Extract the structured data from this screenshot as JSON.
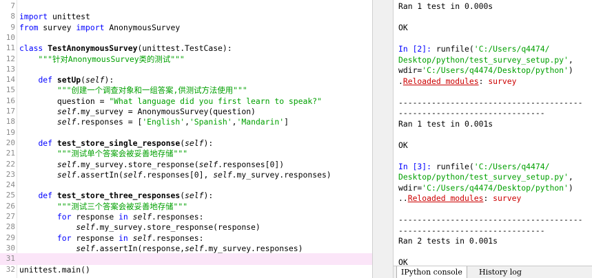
{
  "editor": {
    "lines": [
      {
        "n": "7",
        "parts": []
      },
      {
        "n": "8",
        "parts": [
          [
            "kw",
            "import"
          ],
          [
            "plain",
            " unittest"
          ]
        ]
      },
      {
        "n": "9",
        "parts": [
          [
            "kw",
            "from"
          ],
          [
            "plain",
            " survey "
          ],
          [
            "kw",
            "import"
          ],
          [
            "plain",
            " AnonymousSurvey"
          ]
        ]
      },
      {
        "n": "10",
        "parts": []
      },
      {
        "n": "11",
        "parts": [
          [
            "kw",
            "class"
          ],
          [
            "plain",
            " "
          ],
          [
            "fn",
            "TestAnonymousSurvey"
          ],
          [
            "plain",
            "(unittest.TestCase):"
          ]
        ]
      },
      {
        "n": "12",
        "parts": [
          [
            "str",
            "    \"\"\"针对AnonymousSurvey类的测试\"\"\""
          ]
        ]
      },
      {
        "n": "13",
        "parts": []
      },
      {
        "n": "14",
        "parts": [
          [
            "plain",
            "    "
          ],
          [
            "kw",
            "def"
          ],
          [
            "plain",
            " "
          ],
          [
            "fn",
            "setUp"
          ],
          [
            "plain",
            "("
          ],
          [
            "self",
            "self"
          ],
          [
            "plain",
            "):"
          ]
        ]
      },
      {
        "n": "15",
        "parts": [
          [
            "str",
            "        \"\"\"创建一个调查对象和一组答案,供测试方法使用\"\"\""
          ]
        ]
      },
      {
        "n": "16",
        "parts": [
          [
            "plain",
            "        question = "
          ],
          [
            "str",
            "\"What language did you first learn to speak?\""
          ]
        ]
      },
      {
        "n": "17",
        "parts": [
          [
            "plain",
            "        "
          ],
          [
            "self",
            "self"
          ],
          [
            "plain",
            ".my_survey = AnonymousSurvey(question)"
          ]
        ]
      },
      {
        "n": "18",
        "parts": [
          [
            "plain",
            "        "
          ],
          [
            "self",
            "self"
          ],
          [
            "plain",
            ".responses = ["
          ],
          [
            "str",
            "'English'"
          ],
          [
            "plain",
            ","
          ],
          [
            "str",
            "'Spanish'"
          ],
          [
            "plain",
            ","
          ],
          [
            "str",
            "'Mandarin'"
          ],
          [
            "plain",
            "]"
          ]
        ]
      },
      {
        "n": "19",
        "parts": []
      },
      {
        "n": "20",
        "parts": [
          [
            "plain",
            "    "
          ],
          [
            "kw",
            "def"
          ],
          [
            "plain",
            " "
          ],
          [
            "fn",
            "test_store_single_response"
          ],
          [
            "plain",
            "("
          ],
          [
            "self",
            "self"
          ],
          [
            "plain",
            "):"
          ]
        ]
      },
      {
        "n": "21",
        "parts": [
          [
            "str",
            "        \"\"\"测试单个答案会被妥善地存储\"\"\""
          ]
        ]
      },
      {
        "n": "22",
        "parts": [
          [
            "plain",
            "        "
          ],
          [
            "self",
            "self"
          ],
          [
            "plain",
            ".my_survey.store_response("
          ],
          [
            "self",
            "self"
          ],
          [
            "plain",
            ".responses[0])"
          ]
        ]
      },
      {
        "n": "23",
        "parts": [
          [
            "plain",
            "        "
          ],
          [
            "self",
            "self"
          ],
          [
            "plain",
            ".assertIn("
          ],
          [
            "self",
            "self"
          ],
          [
            "plain",
            ".responses[0], "
          ],
          [
            "self",
            "self"
          ],
          [
            "plain",
            ".my_survey.responses)"
          ]
        ]
      },
      {
        "n": "24",
        "parts": []
      },
      {
        "n": "25",
        "parts": [
          [
            "plain",
            "    "
          ],
          [
            "kw",
            "def"
          ],
          [
            "plain",
            " "
          ],
          [
            "fn",
            "test_store_three_responses"
          ],
          [
            "plain",
            "("
          ],
          [
            "self",
            "self"
          ],
          [
            "plain",
            "):"
          ]
        ]
      },
      {
        "n": "26",
        "parts": [
          [
            "str",
            "        \"\"\"测试三个答案会被妥善地存储\"\"\""
          ]
        ]
      },
      {
        "n": "27",
        "parts": [
          [
            "plain",
            "        "
          ],
          [
            "kw",
            "for"
          ],
          [
            "plain",
            " response "
          ],
          [
            "kw",
            "in"
          ],
          [
            "plain",
            " "
          ],
          [
            "self",
            "self"
          ],
          [
            "plain",
            ".responses:"
          ]
        ]
      },
      {
        "n": "28",
        "parts": [
          [
            "plain",
            "            "
          ],
          [
            "self",
            "self"
          ],
          [
            "plain",
            ".my_survey.store_response(response)"
          ]
        ]
      },
      {
        "n": "29",
        "parts": [
          [
            "plain",
            "        "
          ],
          [
            "kw",
            "for"
          ],
          [
            "plain",
            " response "
          ],
          [
            "kw",
            "in"
          ],
          [
            "plain",
            " "
          ],
          [
            "self",
            "self"
          ],
          [
            "plain",
            ".responses:"
          ]
        ]
      },
      {
        "n": "30",
        "parts": [
          [
            "plain",
            "            "
          ],
          [
            "self",
            "self"
          ],
          [
            "plain",
            ".assertIn(response,"
          ],
          [
            "self",
            "self"
          ],
          [
            "plain",
            ".my_survey.responses)"
          ]
        ]
      },
      {
        "n": "31",
        "parts": [],
        "current": true
      },
      {
        "n": "32",
        "parts": [
          [
            "plain",
            "unittest.main()"
          ]
        ]
      }
    ]
  },
  "console": {
    "lines": [
      [
        [
          "plain",
          "Ran 1 test in 0.000s"
        ]
      ],
      [],
      [
        [
          "plain",
          "OK"
        ]
      ],
      [],
      [
        [
          "prompt",
          "In [2]: "
        ],
        [
          "plain",
          "runfile("
        ],
        [
          "cstr",
          "'C:/Users/q4474/"
        ]
      ],
      [
        [
          "cstr",
          "Desktop/python/test_survey_setup.py'"
        ],
        [
          "plain",
          ","
        ]
      ],
      [
        [
          "plain",
          "wdir="
        ],
        [
          "cstr",
          "'C:/Users/q4474/Desktop/python'"
        ],
        [
          "plain",
          ")"
        ]
      ],
      [
        [
          "dots",
          "."
        ],
        [
          "reload",
          "Reloaded modules"
        ],
        [
          "plain",
          ": "
        ],
        [
          "mod",
          "survey"
        ]
      ],
      [],
      [
        [
          "plain",
          "---------------------------------------"
        ]
      ],
      [
        [
          "plain",
          "-------------------------------"
        ]
      ],
      [
        [
          "plain",
          "Ran 1 test in 0.001s"
        ]
      ],
      [],
      [
        [
          "plain",
          "OK"
        ]
      ],
      [],
      [
        [
          "prompt",
          "In [3]: "
        ],
        [
          "plain",
          "runfile("
        ],
        [
          "cstr",
          "'C:/Users/q4474/"
        ]
      ],
      [
        [
          "cstr",
          "Desktop/python/test_survey_setup.py'"
        ],
        [
          "plain",
          ","
        ]
      ],
      [
        [
          "plain",
          "wdir="
        ],
        [
          "cstr",
          "'C:/Users/q4474/Desktop/python'"
        ],
        [
          "plain",
          ")"
        ]
      ],
      [
        [
          "dots",
          ".."
        ],
        [
          "reload",
          "Reloaded modules"
        ],
        [
          "plain",
          ": "
        ],
        [
          "mod",
          "survey"
        ]
      ],
      [],
      [
        [
          "plain",
          "---------------------------------------"
        ]
      ],
      [
        [
          "plain",
          "-------------------------------"
        ]
      ],
      [
        [
          "plain",
          "Ran 2 tests in 0.001s"
        ]
      ],
      [],
      [
        [
          "plain",
          "OK"
        ]
      ]
    ]
  },
  "tabs": {
    "ipython": "IPython console",
    "history": "History log"
  }
}
